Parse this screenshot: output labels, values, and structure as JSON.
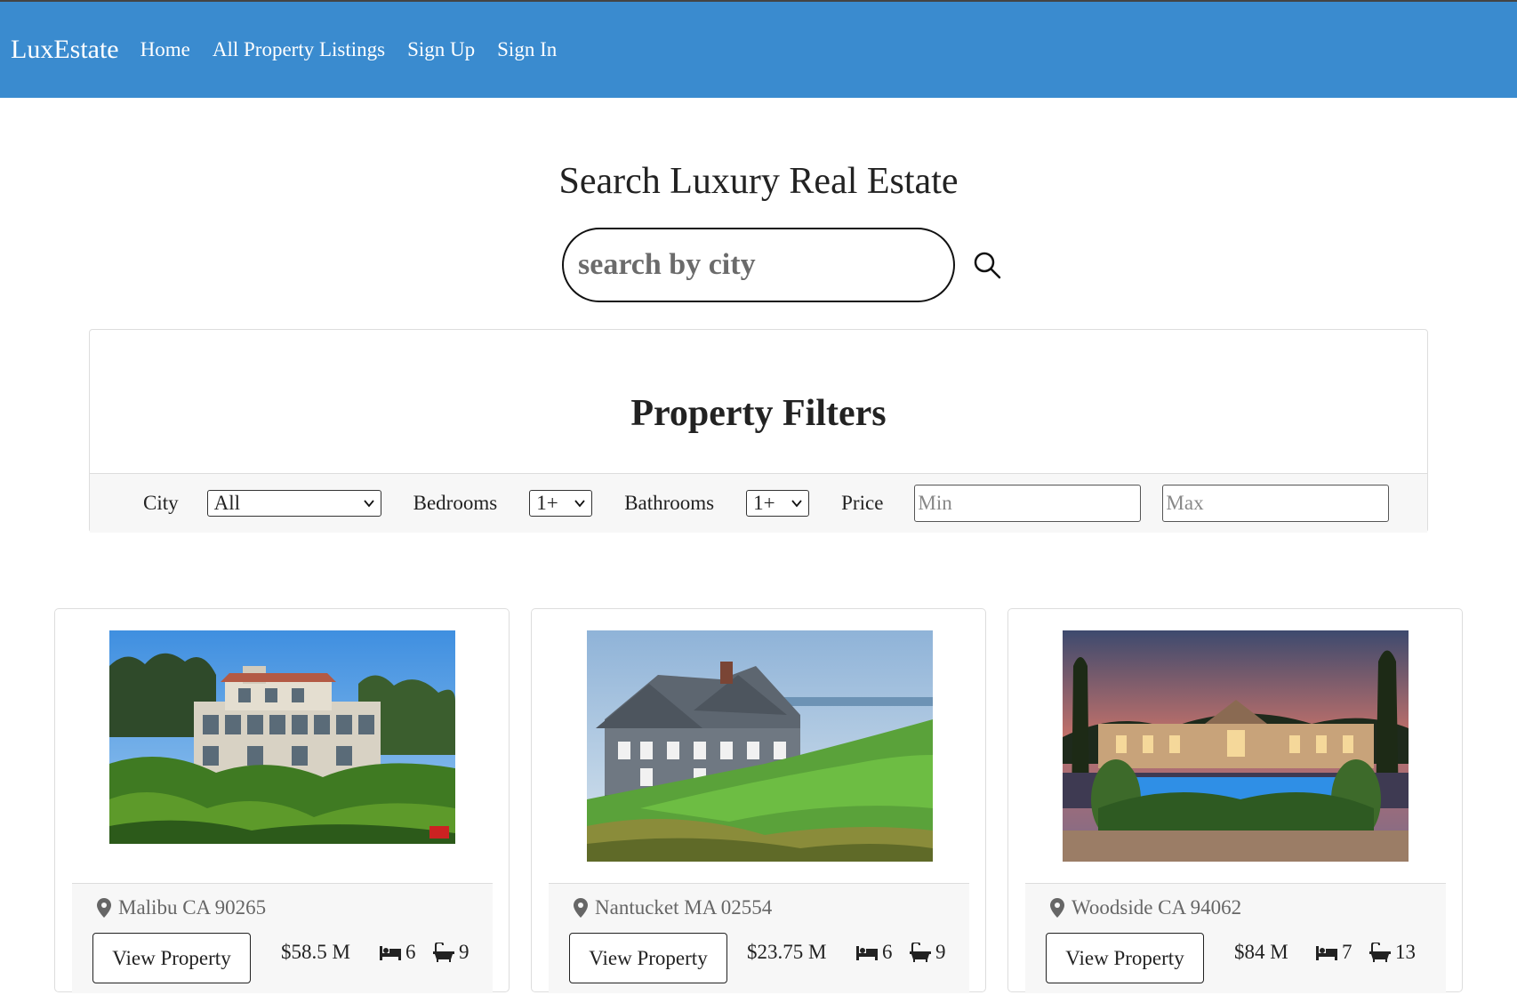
{
  "nav": {
    "brand": "LuxEstate",
    "links": [
      "Home",
      "All Property Listings",
      "Sign Up",
      "Sign In"
    ]
  },
  "hero": {
    "title": "Search Luxury Real Estate",
    "search_placeholder": "search by city"
  },
  "filters": {
    "title": "Property Filters",
    "city_label": "City",
    "city_value": "All",
    "bedrooms_label": "Bedrooms",
    "bedrooms_value": "1+",
    "bathrooms_label": "Bathrooms",
    "bathrooms_value": "1+",
    "price_label": "Price",
    "min_placeholder": "Min",
    "max_placeholder": "Max"
  },
  "listings": [
    {
      "location": "Malibu CA 90265",
      "button": "View Property",
      "price": "$58.5 M",
      "beds": "6",
      "baths": "9"
    },
    {
      "location": "Nantucket MA 02554",
      "button": "View Property",
      "price": "$23.75 M",
      "beds": "6",
      "baths": "9"
    },
    {
      "location": "Woodside CA 94062",
      "button": "View Property",
      "price": "$84 M",
      "beds": "7",
      "baths": "13"
    }
  ],
  "colors": {
    "navbar": "#3a8bcf",
    "filter_bar": "#f7f7f7"
  }
}
